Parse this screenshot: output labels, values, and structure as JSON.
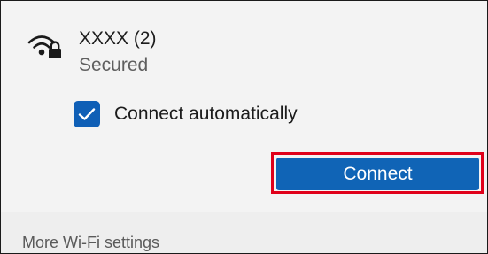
{
  "network": {
    "name": "XXXX (2)",
    "status": "Secured",
    "icon": "wifi-secured-icon"
  },
  "connect_automatically": {
    "label": "Connect automatically",
    "checked": true
  },
  "connect_button": {
    "label": "Connect"
  },
  "footer": {
    "more_settings_label": "More Wi-Fi settings"
  },
  "colors": {
    "accent": "#1064b6",
    "highlight_border": "#e0001a",
    "panel_background": "#f3f3f3"
  }
}
